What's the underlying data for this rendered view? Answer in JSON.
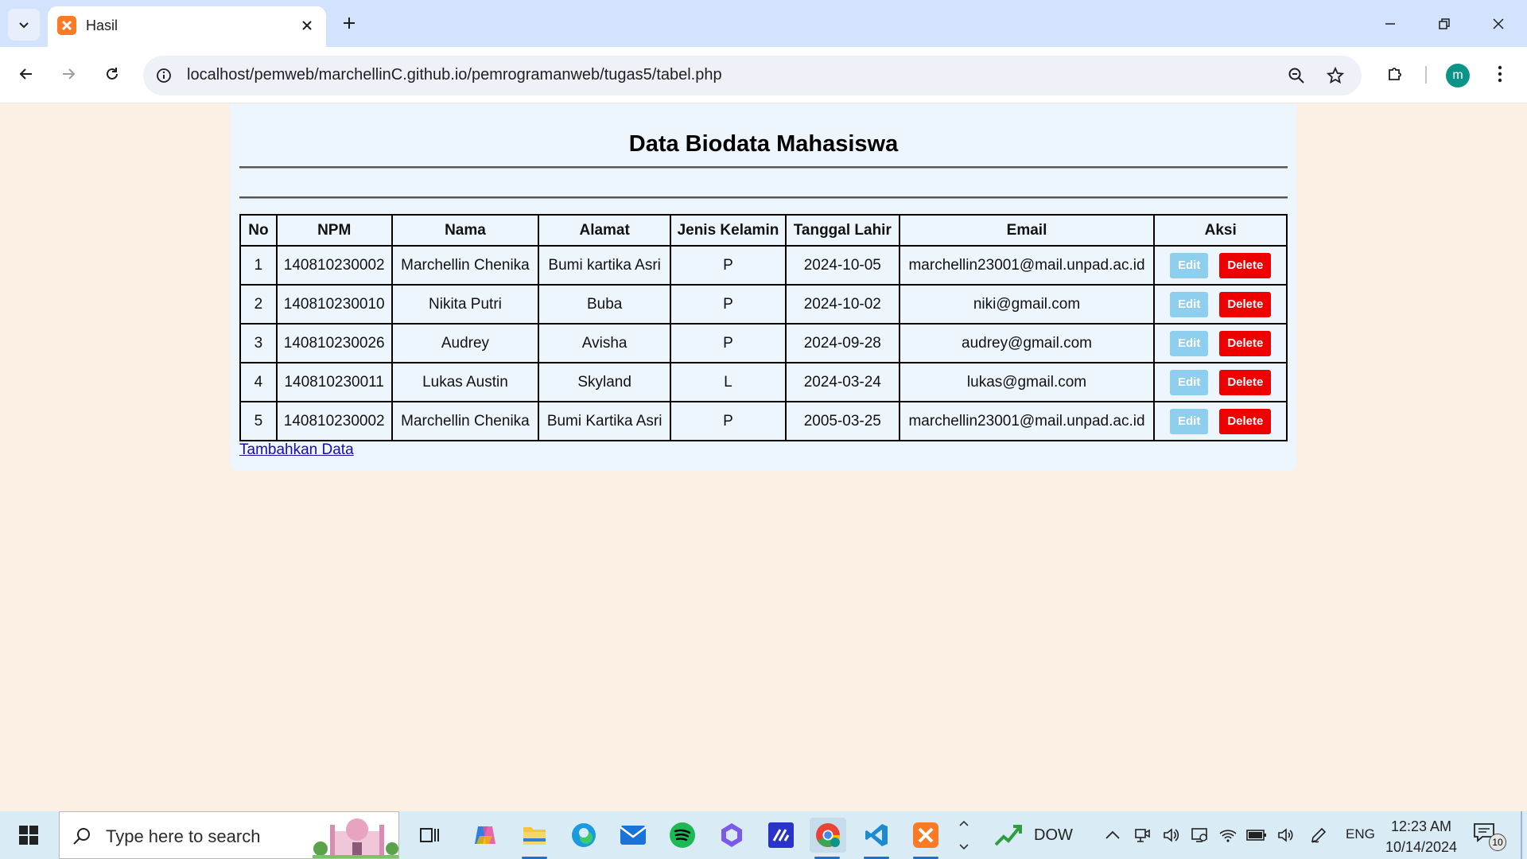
{
  "browser": {
    "tab_title": "Hasil",
    "url": "localhost/pemweb/marchellinC.github.io/pemrogramanweb/tugas5/tabel.php",
    "profile_initial": "m"
  },
  "page": {
    "title": "Data Biodata Mahasiswa",
    "table": {
      "headers": [
        "No",
        "NPM",
        "Nama",
        "Alamat",
        "Jenis Kelamin",
        "Tanggal Lahir",
        "Email",
        "Aksi"
      ],
      "rows": [
        {
          "no": "1",
          "npm": "140810230002",
          "nama": "Marchellin Chenika",
          "alamat": "Bumi kartika Asri",
          "jk": "P",
          "tgl": "2024-10-05",
          "email": "marchellin23001@mail.unpad.ac.id"
        },
        {
          "no": "2",
          "npm": "140810230010",
          "nama": "Nikita Putri",
          "alamat": "Buba",
          "jk": "P",
          "tgl": "2024-10-02",
          "email": "niki@gmail.com"
        },
        {
          "no": "3",
          "npm": "140810230026",
          "nama": "Audrey",
          "alamat": "Avisha",
          "jk": "P",
          "tgl": "2024-09-28",
          "email": "audrey@gmail.com"
        },
        {
          "no": "4",
          "npm": "140810230011",
          "nama": "Lukas Austin",
          "alamat": "Skyland",
          "jk": "L",
          "tgl": "2024-03-24",
          "email": "lukas@gmail.com"
        },
        {
          "no": "5",
          "npm": "140810230002",
          "nama": "Marchellin Chenika",
          "alamat": "Bumi Kartika Asri",
          "jk": "P",
          "tgl": "2005-03-25",
          "email": "marchellin23001@mail.unpad.ac.id"
        }
      ],
      "edit_label": "Edit",
      "delete_label": "Delete"
    },
    "add_link": "Tambahkan Data"
  },
  "taskbar": {
    "search_placeholder": "Type here to search",
    "stock_label": "DOW",
    "language": "ENG",
    "time": "12:23 AM",
    "date": "10/14/2024",
    "notification_count": "10"
  },
  "colors": {
    "page_bg": "#fcefe3",
    "container_bg": "#eef6fd",
    "edit_button": "#8ecff0",
    "delete_button": "#ee0000",
    "link": "#1a0dab"
  }
}
